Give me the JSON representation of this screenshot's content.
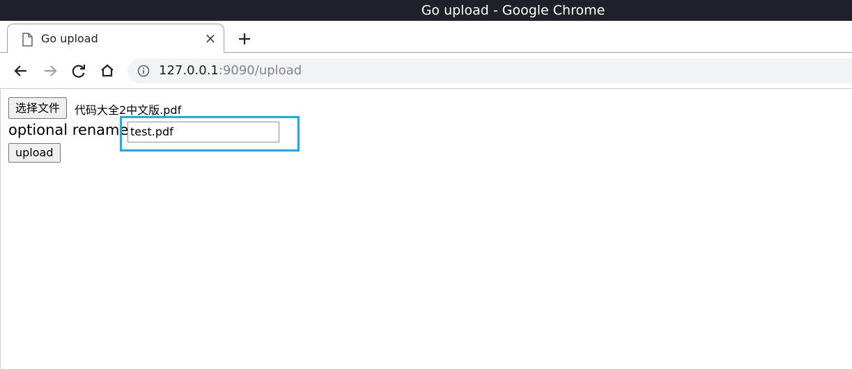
{
  "window": {
    "title": "Go upload - Google Chrome"
  },
  "tab": {
    "title": "Go upload",
    "close_glyph": "×",
    "icon": "page-icon"
  },
  "new_tab": {
    "icon": "plus-icon"
  },
  "nav": {
    "back_icon": "back-arrow-icon",
    "forward_icon": "forward-arrow-icon",
    "reload_icon": "reload-icon",
    "home_icon": "home-icon"
  },
  "omnibox": {
    "info_icon": "info-icon",
    "host": "127.0.0.1",
    "path": ":9090/upload"
  },
  "form": {
    "file_button_label": "选择文件",
    "file_name": "代码大全2中文版.pdf",
    "rename_label": "optional rename:",
    "rename_value": "test.pdf",
    "upload_button_label": "upload",
    "highlight_color": "#17aee8"
  }
}
